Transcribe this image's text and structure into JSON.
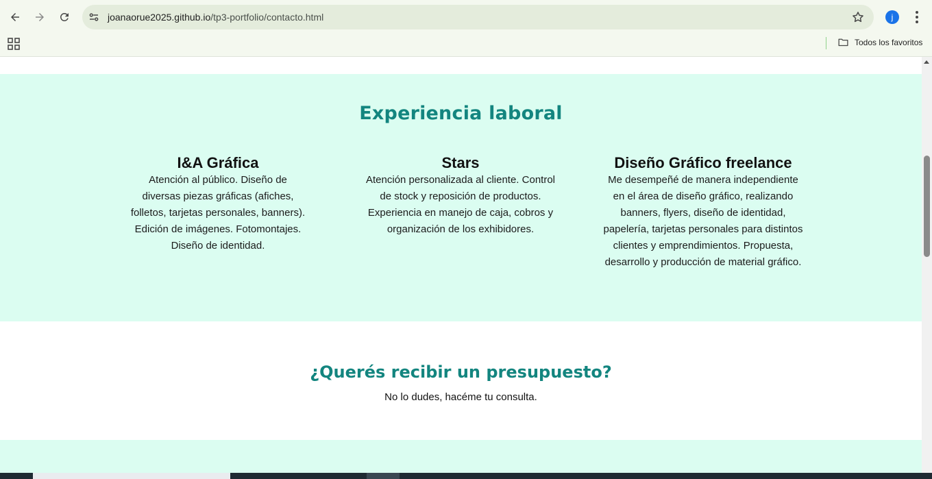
{
  "browser": {
    "url_host": "joanaorue2025.github.io",
    "url_path": "/tp3-portfolio/contacto.html",
    "profile_initial": "j",
    "bookmarks_all_label": "Todos los favoritos"
  },
  "experience": {
    "title": "Experiencia laboral",
    "jobs": [
      {
        "title": "I&A Gráfica",
        "description": "Atención al público. Diseño de diversas piezas gráficas (afiches, folletos, tarjetas personales, banners). Edición de imágenes. Fotomontajes. Diseño de identidad."
      },
      {
        "title": "Stars",
        "description": "Atención personalizada al cliente. Control de stock y reposición de productos. Experiencia en manejo de caja, cobros y organización de los exhibidores."
      },
      {
        "title": "Diseño Gráfico freelance",
        "description": "Me desempeñé de manera independiente en el área de diseño gráfico, realizando banners, flyers, diseño de identidad, papelería, tarjetas personales para distintos clientes y emprendimientos. Propuesta, desarrollo y producción de material gráfico."
      }
    ]
  },
  "quote": {
    "title": "¿Querés recibir un presupuesto?",
    "subtitle": "No lo dudes, hacéme tu consulta."
  },
  "colors": {
    "accent": "#13857f",
    "section_bg": "#dbfdf1",
    "chrome_bg": "#f4f8ef"
  }
}
